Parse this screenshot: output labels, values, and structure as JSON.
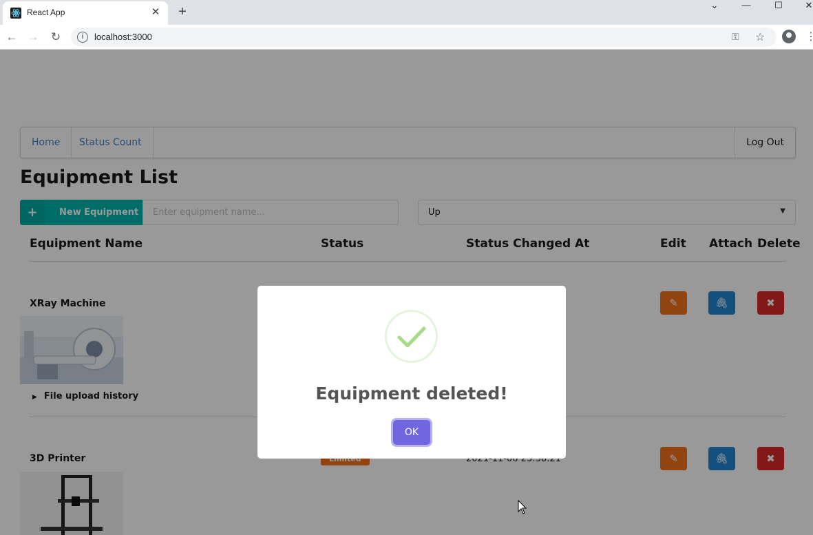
{
  "browser": {
    "tab_title": "React App",
    "url": "localhost:3000",
    "new_tab_symbol": "+",
    "close_symbol": "✕"
  },
  "nav": {
    "home": "Home",
    "status_count": "Status Count",
    "logout": "Log Out"
  },
  "page_title": "Equipment List",
  "toolbar": {
    "new_button_label": "New Equipment",
    "search_placeholder": "Enter equipment name...",
    "status_filter_value": "Up"
  },
  "table": {
    "headers": [
      "Equipment Name",
      "Status",
      "Status Changed At",
      "Edit",
      "Attach",
      "Delete"
    ],
    "rows": [
      {
        "name": "XRay Machine",
        "upload_history_label": "File upload history"
      },
      {
        "name": "3D Printer",
        "status": "Limited",
        "status_changed_at": "2021-11-06 23:38:21"
      }
    ]
  },
  "modal": {
    "title": "Equipment deleted!",
    "ok_label": "OK"
  },
  "colors": {
    "teal": "#00b5ad",
    "orange": "#f2711c",
    "blue": "#2185d0",
    "red": "#db2828",
    "swal_confirm": "#7066e0",
    "success_green": "#a5dc86"
  },
  "icons": [
    "react-logo-icon",
    "plus-icon",
    "edit-icon",
    "paperclip-icon",
    "delete-icon",
    "success-check-icon"
  ]
}
